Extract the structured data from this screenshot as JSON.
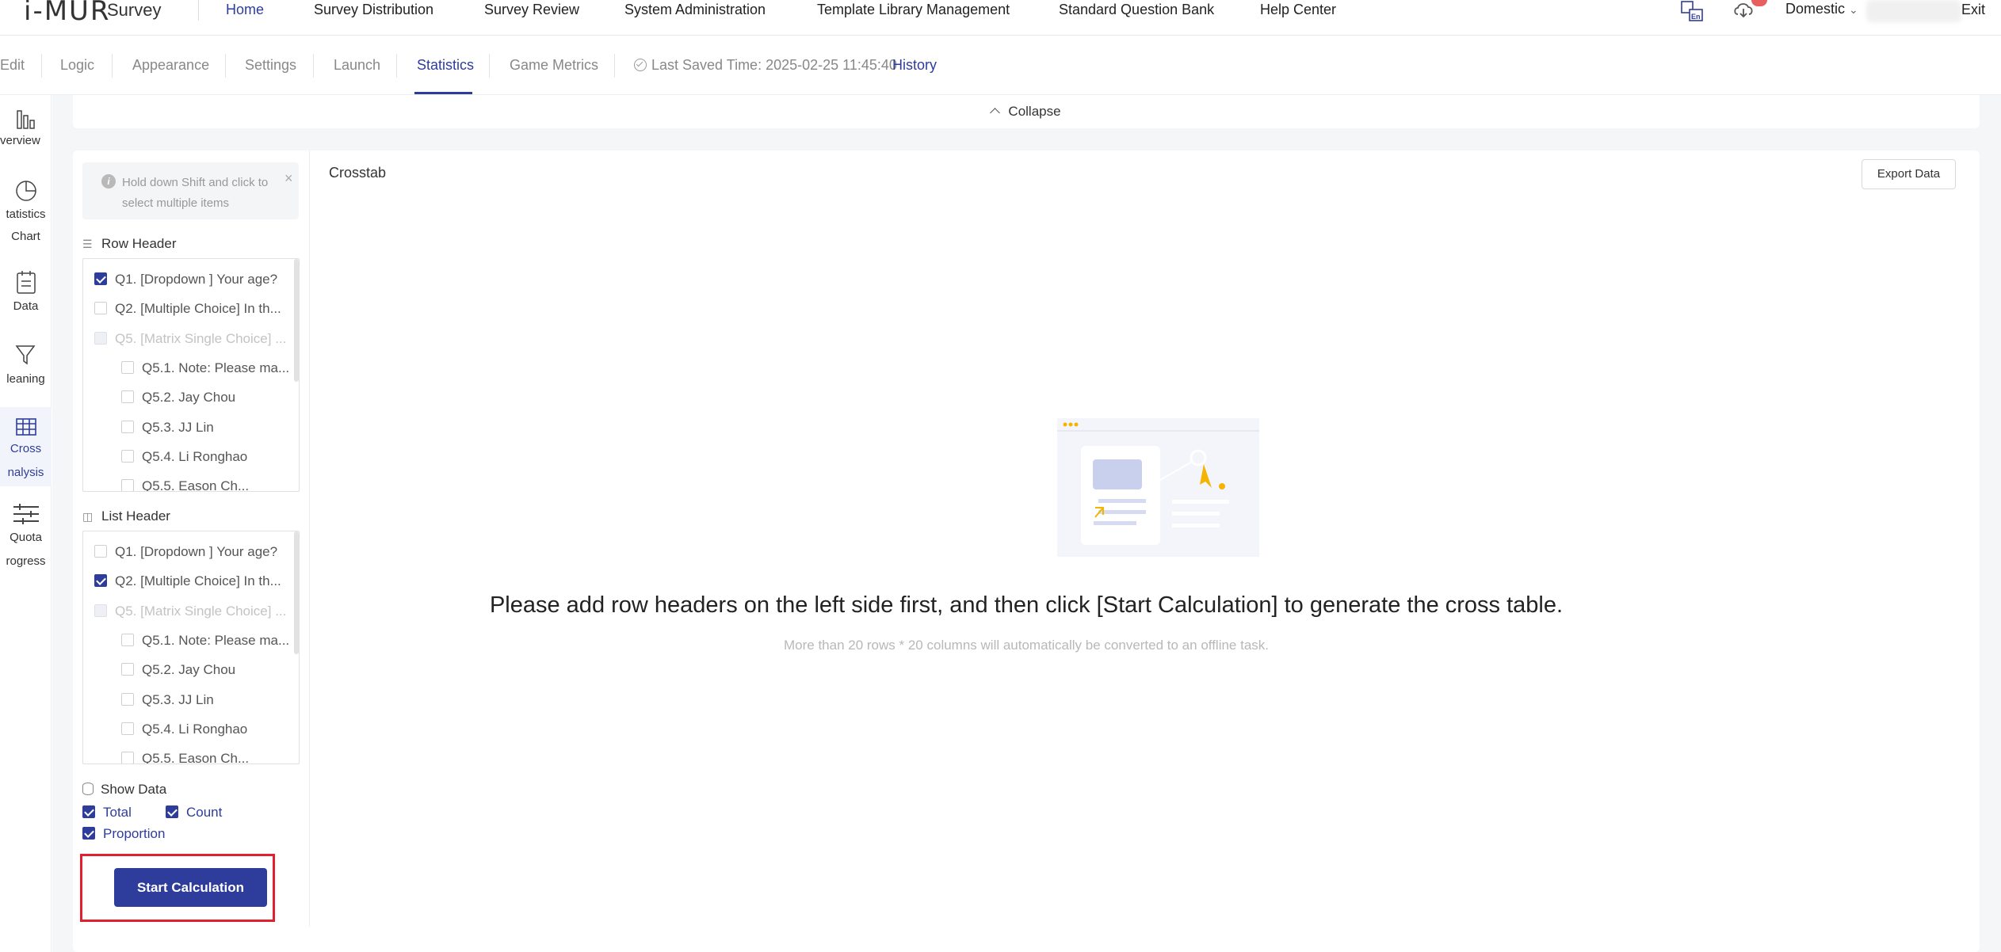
{
  "app": {
    "logo_text": "i-MUR",
    "logo_sub": "Survey"
  },
  "topnav": {
    "items": [
      {
        "label": "Home",
        "active": true
      },
      {
        "label": "Survey Distribution"
      },
      {
        "label": "Survey Review"
      },
      {
        "label": "System Administration"
      },
      {
        "label": "Template Library Management"
      },
      {
        "label": "Standard Question Bank"
      },
      {
        "label": "Help Center"
      }
    ],
    "region": "Domestic",
    "exit": "Exit"
  },
  "subnav": {
    "tabs": [
      {
        "label": "Edit"
      },
      {
        "label": "Logic"
      },
      {
        "label": "Appearance"
      },
      {
        "label": "Settings"
      },
      {
        "label": "Launch"
      },
      {
        "label": "Statistics",
        "active": true
      },
      {
        "label": "Game Metrics"
      }
    ],
    "saved_text": "Last Saved Time: 2025-02-25 11:45:40",
    "history": "History"
  },
  "rail": {
    "items": [
      {
        "label1": "verview",
        "label2": ""
      },
      {
        "label1": "tatistics",
        "label2": "Chart"
      },
      {
        "label1": "Data",
        "label2": ""
      },
      {
        "label1": "leaning",
        "label2": ""
      },
      {
        "label1": "Cross",
        "label2": "nalysis",
        "active": true
      },
      {
        "label1": "Quota",
        "label2": "rogress"
      }
    ]
  },
  "collapse": "Collapse",
  "left_panel": {
    "tip": "Hold down Shift and click to select multiple items",
    "row_header": {
      "title": "Row Header",
      "items": [
        {
          "label": "Q1. [Dropdown ] Your age?",
          "checked": true
        },
        {
          "label": "Q2. [Multiple Choice] In th...",
          "checked": false
        },
        {
          "label": "Q5. [Matrix Single Choice] ...",
          "disabled": true
        },
        {
          "label": "Q5.1. Note: Please ma...",
          "indent": true
        },
        {
          "label": "Q5.2. Jay Chou",
          "indent": true
        },
        {
          "label": "Q5.3. JJ Lin",
          "indent": true
        },
        {
          "label": "Q5.4. Li Ronghao",
          "indent": true
        },
        {
          "label": "Q5.5. Eason Ch...",
          "indent": true
        }
      ]
    },
    "list_header": {
      "title": "List Header",
      "items": [
        {
          "label": "Q1. [Dropdown ] Your age?",
          "checked": false
        },
        {
          "label": "Q2. [Multiple Choice] In th...",
          "checked": true
        },
        {
          "label": "Q5. [Matrix Single Choice] ...",
          "disabled": true
        },
        {
          "label": "Q5.1. Note: Please ma...",
          "indent": true
        },
        {
          "label": "Q5.2. Jay Chou",
          "indent": true
        },
        {
          "label": "Q5.3. JJ Lin",
          "indent": true
        },
        {
          "label": "Q5.4. Li Ronghao",
          "indent": true
        },
        {
          "label": "Q5.5. Eason Ch...",
          "indent": true
        }
      ]
    },
    "show_data": {
      "title": "Show Data",
      "options": [
        {
          "label": "Total",
          "checked": true
        },
        {
          "label": "Count",
          "checked": true
        },
        {
          "label": "Proportion",
          "checked": true
        }
      ]
    },
    "start_button": "Start Calculation"
  },
  "content": {
    "title": "Crosstab",
    "export": "Export Data",
    "empty_main": "Please add row headers on the left side first, and then click [Start Calculation] to generate the cross table.",
    "empty_sub": "More than 20 rows * 20 columns will automatically be converted to an offline task."
  },
  "colors": {
    "primary": "#2e3d9b",
    "highlight_border": "#e0202e",
    "accent": "#f5b400"
  }
}
